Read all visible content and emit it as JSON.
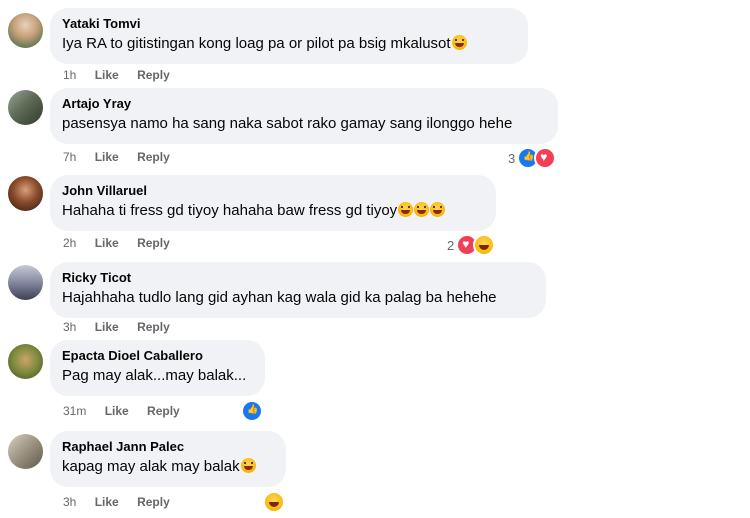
{
  "comments": [
    {
      "author": "Yataki Tomvi",
      "text": "Iya RA to gitistingan kong loag pa or pilot pa bsig mkalusot",
      "time": "1h",
      "like": "Like",
      "reply": "Reply",
      "reaction_count": ""
    },
    {
      "author": "Artajo Yray",
      "text": "pasensya namo ha sang naka sabot rako gamay sang ilonggo hehe",
      "time": "7h",
      "like": "Like",
      "reply": "Reply",
      "reaction_count": "3"
    },
    {
      "author": "John Villaruel",
      "text": "Hahaha ti fress gd tiyoy hahaha baw fress gd tiyoy",
      "time": "2h",
      "like": "Like",
      "reply": "Reply",
      "reaction_count": "2"
    },
    {
      "author": "Ricky Ticot",
      "text": "Hajahhaha tudlo lang gid ayhan kag wala gid ka palag ba hehehe",
      "time": "3h",
      "like": "Like",
      "reply": "Reply",
      "reaction_count": ""
    },
    {
      "author": "Epacta Dioel Caballero",
      "text": "Pag may alak...may balak...",
      "time": "31m",
      "like": "Like",
      "reply": "Reply",
      "reaction_count": ""
    },
    {
      "author": "Raphael Jann Palec",
      "text": "kapag may alak may balak",
      "time": "3h",
      "like": "Like",
      "reply": "Reply",
      "reaction_count": ""
    }
  ],
  "colors": {
    "bubble": "#f0f2f5",
    "meta": "#65676b",
    "like": "#1877f2",
    "love": "#f33e58"
  }
}
